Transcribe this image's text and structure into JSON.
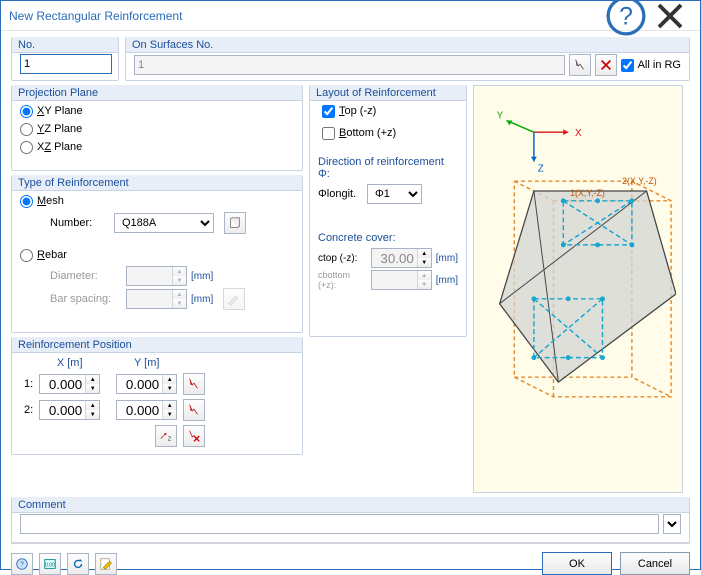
{
  "window": {
    "title": "New Rectangular Reinforcement"
  },
  "no": {
    "legend": "No.",
    "value": "1"
  },
  "surfaces": {
    "legend": "On Surfaces No.",
    "value": "1",
    "all_label": "All in RG",
    "all_checked": true
  },
  "projection": {
    "legend": "Projection Plane",
    "opts": {
      "xy": "XY Plane",
      "yz": "YZ Plane",
      "xz": "XZ Plane"
    },
    "selected": "xy"
  },
  "type": {
    "legend": "Type of Reinforcement",
    "mesh_label": "Mesh",
    "mesh_number_label": "Number:",
    "mesh_number_value": "Q188A",
    "rebar_label": "Rebar",
    "diameter_label": "Diameter:",
    "diameter_value": "",
    "barspacing_label": "Bar spacing:",
    "barspacing_value": "",
    "unit_mm": "[mm]",
    "selected": "mesh"
  },
  "position": {
    "legend": "Reinforcement Position",
    "xhead": "X [m]",
    "yhead": "Y [m]",
    "row1_label": "1:",
    "row2_label": "2:",
    "r1x": "0.000",
    "r1y": "0.000",
    "r2x": "0.000",
    "r2y": "0.000"
  },
  "layout": {
    "legend": "Layout of Reinforcement",
    "top_label": "Top (-z)",
    "top_checked": true,
    "bottom_label": "Bottom (+z)",
    "bottom_checked": false,
    "direction_legend": "Direction of reinforcement Φ:",
    "phi_label": "Φlongit.",
    "phi_value": "Φ1",
    "cover_legend": "Concrete cover:",
    "ctop_label": "ctop (-z):",
    "ctop_value": "30.00",
    "cbot_label": "cbottom (+z):",
    "cbot_value": "",
    "unit_mm": "[mm]"
  },
  "comment": {
    "legend": "Comment",
    "value": ""
  },
  "footer": {
    "ok": "OK",
    "cancel": "Cancel"
  },
  "preview": {
    "axis_x": "X",
    "axis_y": "Y",
    "axis_z": "Z",
    "label1": "1(X,Y,-Z)",
    "label2": "2(X,Y,-Z)"
  }
}
